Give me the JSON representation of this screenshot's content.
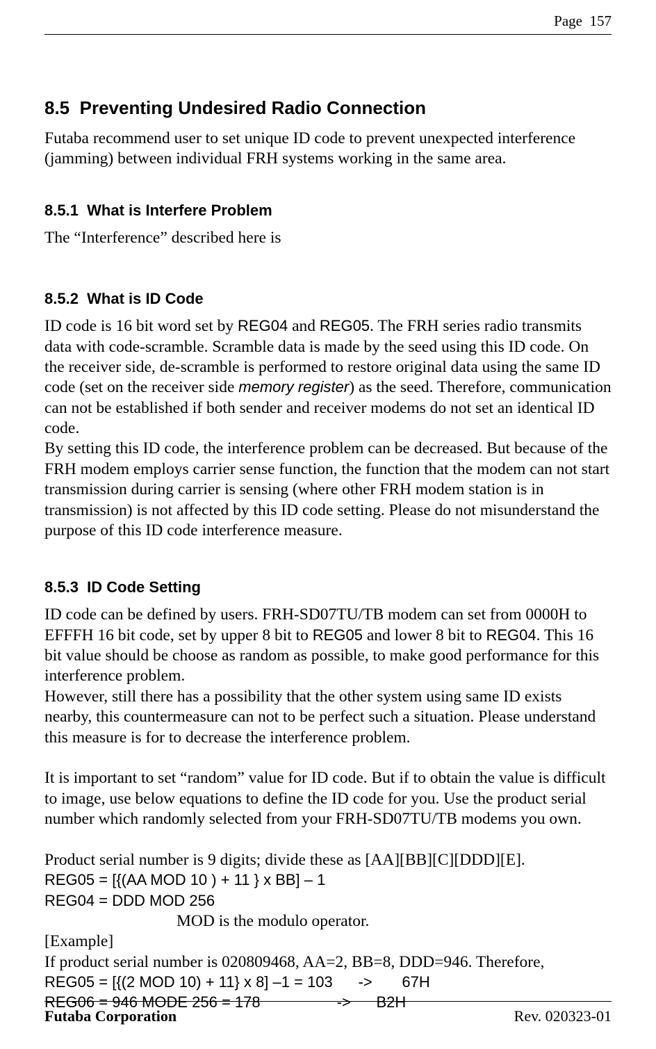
{
  "page": {
    "header_label": "Page",
    "number": "157"
  },
  "section": {
    "number": "8.5",
    "title": "Preventing Undesired Radio Connection",
    "intro": "Futaba recommend user to set unique ID code to prevent unexpected interference (jamming) between individual FRH systems working in the same area."
  },
  "sub1": {
    "number": "8.5.1",
    "title": "What is Interfere Problem",
    "body": "The “Interference” described here is"
  },
  "sub2": {
    "number": "8.5.2",
    "title": "What is ID Code",
    "p1_a": "ID code is 16 bit word set by ",
    "reg04": "REG04",
    "p1_b": " and ",
    "reg05": "REG05",
    "p1_c": ". The FRH series radio transmits data with code-scramble. Scramble data is made by the seed using this ID code. On the receiver side, de-scramble is performed to restore original data using the same ID code (set on the receiver side ",
    "memreg": "memory register",
    "p1_d": ") as the seed. Therefore, communication can not be established if both sender and receiver modems do not set an identical ID code.",
    "p2": "By setting this ID code, the interference problem can be decreased. But because of the FRH modem employs carrier sense function, the function that the modem can not start transmission during carrier is sensing (where other FRH modem station is in transmission) is not affected by this ID code setting. Please do not misunderstand the purpose of this ID code interference measure."
  },
  "sub3": {
    "number": "8.5.3",
    "title": "ID Code Setting",
    "p1_a": "ID code can be defined by users. FRH-SD07TU/TB modem can set from 0000H to EFFFH 16 bit code, set by upper 8 bit to ",
    "reg05": "REG05",
    "p1_b": " and lower 8 bit to ",
    "reg04": "REG04",
    "p1_c": ". This 16 bit value should be choose as random as possible, to make good performance for this interference problem.",
    "p2": "However, still there has a possibility that the other system using same ID exists nearby, this countermeasure can not to be perfect such a situation. Please understand this measure is for to decrease the interference problem.",
    "p3": "It is important to set “random” value for ID code. But if to obtain the value is difficult to image, use below equations to define the ID code for you. Use the product serial number which randomly selected from your FRH-SD07TU/TB modems you own.",
    "serial_note": "Product serial number is 9 digits; divide these as [AA][BB][C][DDD][E].",
    "eq1": "REG05 = [{(AA MOD 10 ) + 11 }  x  BB] – 1",
    "eq2": "REG04 = DDD MOD 256",
    "mod_note": "MOD is the modulo operator.",
    "example_label": "[Example]",
    "example_text": "If product serial number is 020809468, AA=2, BB=8, DDD=946. Therefore,",
    "example_r1": "REG05 = [{(2 MOD 10) + 11} x 8] –1 = 103      ->       67H",
    "example_r2": "REG06 = 946 MODE 256 = 178                  ->      B2H"
  },
  "footer": {
    "corp": "Futaba Corporation",
    "rev": "Rev. 020323-01"
  }
}
